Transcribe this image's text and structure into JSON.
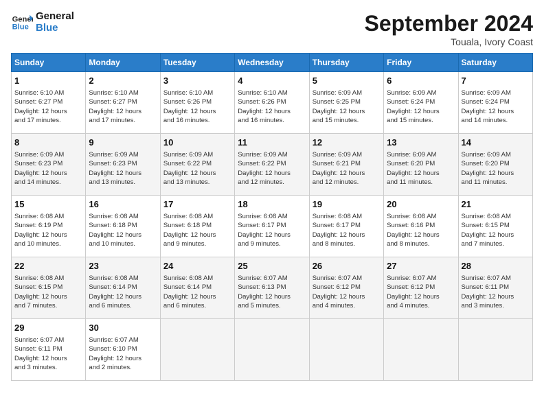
{
  "logo": {
    "line1": "General",
    "line2": "Blue"
  },
  "title": "September 2024",
  "subtitle": "Touala, Ivory Coast",
  "days_of_week": [
    "Sunday",
    "Monday",
    "Tuesday",
    "Wednesday",
    "Thursday",
    "Friday",
    "Saturday"
  ],
  "weeks": [
    [
      {
        "day": "1",
        "sunrise": "6:10 AM",
        "sunset": "6:27 PM",
        "daylight": "12 hours and 17 minutes."
      },
      {
        "day": "2",
        "sunrise": "6:10 AM",
        "sunset": "6:27 PM",
        "daylight": "12 hours and 17 minutes."
      },
      {
        "day": "3",
        "sunrise": "6:10 AM",
        "sunset": "6:26 PM",
        "daylight": "12 hours and 16 minutes."
      },
      {
        "day": "4",
        "sunrise": "6:10 AM",
        "sunset": "6:26 PM",
        "daylight": "12 hours and 16 minutes."
      },
      {
        "day": "5",
        "sunrise": "6:09 AM",
        "sunset": "6:25 PM",
        "daylight": "12 hours and 15 minutes."
      },
      {
        "day": "6",
        "sunrise": "6:09 AM",
        "sunset": "6:24 PM",
        "daylight": "12 hours and 15 minutes."
      },
      {
        "day": "7",
        "sunrise": "6:09 AM",
        "sunset": "6:24 PM",
        "daylight": "12 hours and 14 minutes."
      }
    ],
    [
      {
        "day": "8",
        "sunrise": "6:09 AM",
        "sunset": "6:23 PM",
        "daylight": "12 hours and 14 minutes."
      },
      {
        "day": "9",
        "sunrise": "6:09 AM",
        "sunset": "6:23 PM",
        "daylight": "12 hours and 13 minutes."
      },
      {
        "day": "10",
        "sunrise": "6:09 AM",
        "sunset": "6:22 PM",
        "daylight": "12 hours and 13 minutes."
      },
      {
        "day": "11",
        "sunrise": "6:09 AM",
        "sunset": "6:22 PM",
        "daylight": "12 hours and 12 minutes."
      },
      {
        "day": "12",
        "sunrise": "6:09 AM",
        "sunset": "6:21 PM",
        "daylight": "12 hours and 12 minutes."
      },
      {
        "day": "13",
        "sunrise": "6:09 AM",
        "sunset": "6:20 PM",
        "daylight": "12 hours and 11 minutes."
      },
      {
        "day": "14",
        "sunrise": "6:09 AM",
        "sunset": "6:20 PM",
        "daylight": "12 hours and 11 minutes."
      }
    ],
    [
      {
        "day": "15",
        "sunrise": "6:08 AM",
        "sunset": "6:19 PM",
        "daylight": "12 hours and 10 minutes."
      },
      {
        "day": "16",
        "sunrise": "6:08 AM",
        "sunset": "6:18 PM",
        "daylight": "12 hours and 10 minutes."
      },
      {
        "day": "17",
        "sunrise": "6:08 AM",
        "sunset": "6:18 PM",
        "daylight": "12 hours and 9 minutes."
      },
      {
        "day": "18",
        "sunrise": "6:08 AM",
        "sunset": "6:17 PM",
        "daylight": "12 hours and 9 minutes."
      },
      {
        "day": "19",
        "sunrise": "6:08 AM",
        "sunset": "6:17 PM",
        "daylight": "12 hours and 8 minutes."
      },
      {
        "day": "20",
        "sunrise": "6:08 AM",
        "sunset": "6:16 PM",
        "daylight": "12 hours and 8 minutes."
      },
      {
        "day": "21",
        "sunrise": "6:08 AM",
        "sunset": "6:15 PM",
        "daylight": "12 hours and 7 minutes."
      }
    ],
    [
      {
        "day": "22",
        "sunrise": "6:08 AM",
        "sunset": "6:15 PM",
        "daylight": "12 hours and 7 minutes."
      },
      {
        "day": "23",
        "sunrise": "6:08 AM",
        "sunset": "6:14 PM",
        "daylight": "12 hours and 6 minutes."
      },
      {
        "day": "24",
        "sunrise": "6:08 AM",
        "sunset": "6:14 PM",
        "daylight": "12 hours and 6 minutes."
      },
      {
        "day": "25",
        "sunrise": "6:07 AM",
        "sunset": "6:13 PM",
        "daylight": "12 hours and 5 minutes."
      },
      {
        "day": "26",
        "sunrise": "6:07 AM",
        "sunset": "6:12 PM",
        "daylight": "12 hours and 4 minutes."
      },
      {
        "day": "27",
        "sunrise": "6:07 AM",
        "sunset": "6:12 PM",
        "daylight": "12 hours and 4 minutes."
      },
      {
        "day": "28",
        "sunrise": "6:07 AM",
        "sunset": "6:11 PM",
        "daylight": "12 hours and 3 minutes."
      }
    ],
    [
      {
        "day": "29",
        "sunrise": "6:07 AM",
        "sunset": "6:11 PM",
        "daylight": "12 hours and 3 minutes."
      },
      {
        "day": "30",
        "sunrise": "6:07 AM",
        "sunset": "6:10 PM",
        "daylight": "12 hours and 2 minutes."
      },
      null,
      null,
      null,
      null,
      null
    ]
  ]
}
